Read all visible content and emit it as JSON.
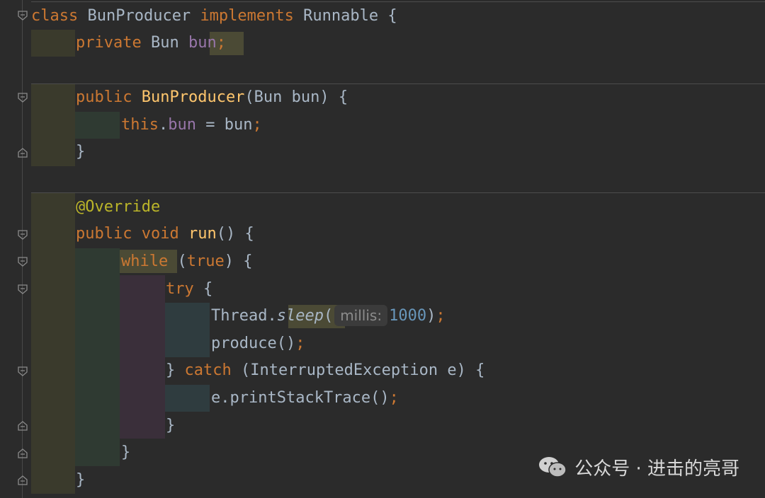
{
  "code": {
    "line1": {
      "kw1": "class",
      "name": "BunProducer",
      "kw2": "implements",
      "iface": "Runnable",
      "brace": "{"
    },
    "line2": {
      "kw": "private",
      "type": "Bun",
      "field": "bun",
      "semi": ";"
    },
    "line4": {
      "kw": "public",
      "name": "BunProducer",
      "params": "(Bun bun)",
      "brace": "{"
    },
    "line5": {
      "kw": "this",
      "dot": ".",
      "field": "bun",
      "rest": " = bun",
      "semi": ";"
    },
    "line6": {
      "brace": "}"
    },
    "line8": {
      "ann": "@Override"
    },
    "line9": {
      "kw1": "public",
      "kw2": "void",
      "name": "run",
      "rest": "()",
      "brace": "{"
    },
    "line10": {
      "kw": "while",
      "open": " (",
      "val": "true",
      "close": ") {"
    },
    "line11": {
      "kw": "try",
      "brace": " {"
    },
    "line12": {
      "cls": "Thread.",
      "method": "sleep",
      "open": "(",
      "hint": "millis:",
      "num": "1000",
      "close": ")",
      "semi": ";"
    },
    "line13": {
      "call": "produce()",
      "semi": ";"
    },
    "line14": {
      "brace1": "} ",
      "kw": "catch",
      "rest": " (InterruptedException e) {"
    },
    "line15": {
      "call": "e.printStackTrace()",
      "semi": ";"
    },
    "line16": {
      "brace": "}"
    },
    "line17": {
      "brace": "}"
    },
    "line18": {
      "brace": "}"
    }
  },
  "watermark": {
    "text": "公众号 · 进击的亮哥",
    "icon": "wechat-icon"
  },
  "colors": {
    "background": "#2b2b2b",
    "keyword": "#cc7832",
    "method": "#ffc66d",
    "field": "#9876aa",
    "annotation": "#bbb529",
    "number": "#6897bb"
  }
}
